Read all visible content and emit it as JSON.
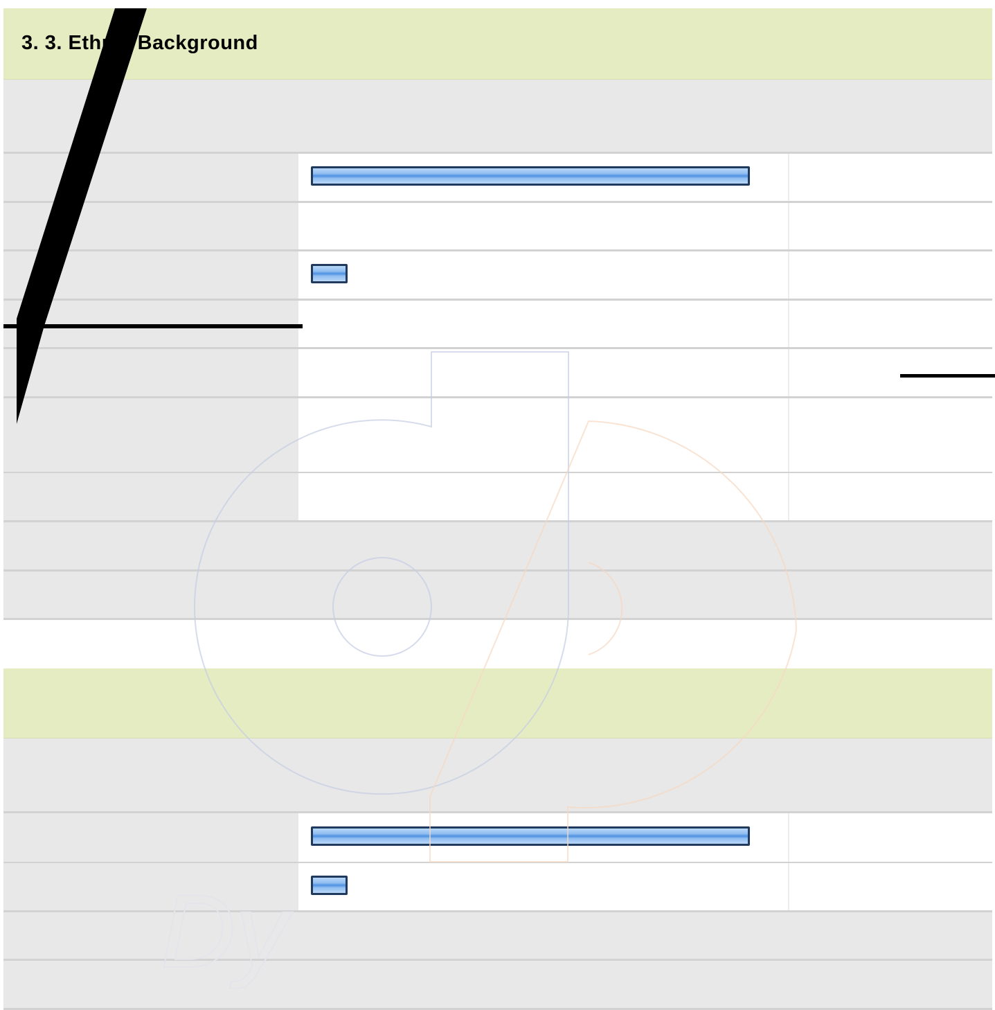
{
  "section1": {
    "title": "3. 3. Ethnic Background",
    "rows": [
      {
        "fraction": 1.0
      },
      {
        "fraction": 0.0
      },
      {
        "fraction": 0.08
      },
      {
        "fraction": 0.0
      },
      {
        "fraction": 0.0
      },
      {
        "fraction": 0.0
      },
      {
        "fraction": 0.0
      }
    ]
  },
  "section2": {
    "title": "",
    "rows": [
      {
        "fraction": 1.0
      },
      {
        "fraction": 0.08
      }
    ]
  },
  "watermark": {
    "text": "Dy",
    "colors": {
      "blue": "#c5cde3",
      "orange": "#f6d8c2"
    }
  },
  "colors": {
    "header_band": "#e6ecc2",
    "label_bg": "#e8e8e8",
    "bar_border": "#1f3a5c",
    "bar_fill": "#8fbdf0"
  }
}
